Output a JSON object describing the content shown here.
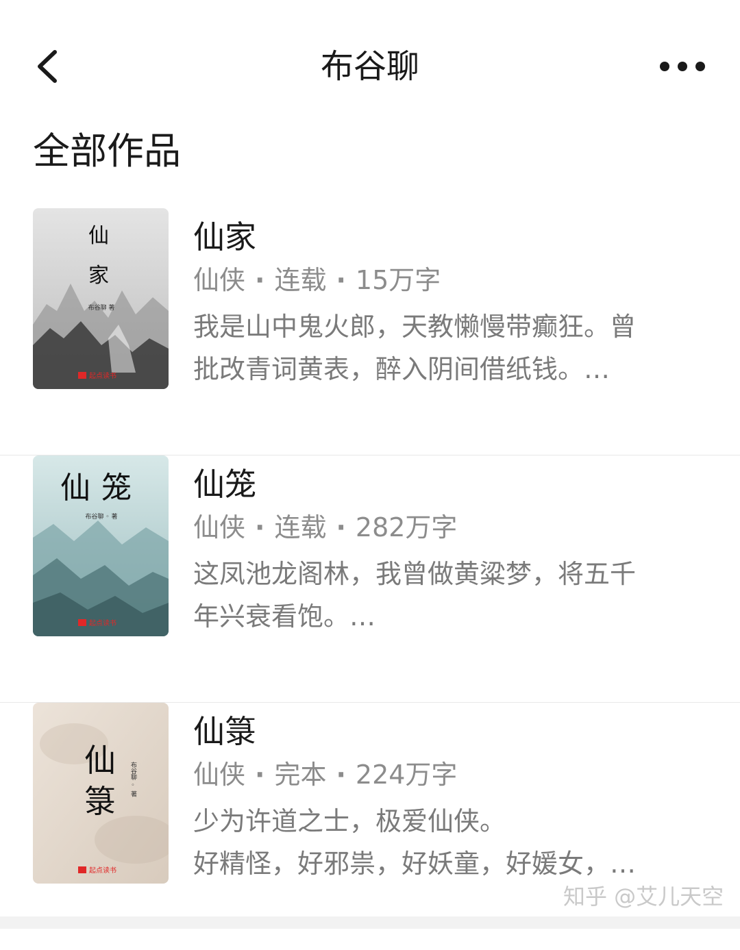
{
  "header": {
    "back_icon": "chevron-left-icon",
    "title": "布谷聊",
    "more_icon": "more-horizontal-icon"
  },
  "section": {
    "title": "全部作品"
  },
  "books": [
    {
      "title": "仙家",
      "genre": "仙侠",
      "status": "连载",
      "words": "15万字",
      "desc_lines": [
        "我是山中鬼火郎，天教懒慢带癫狂。曾",
        "批改青词黄表，醉入阴间借纸钱。…"
      ],
      "cover": {
        "title_chars": [
          "仙",
          "家"
        ],
        "author": "布谷聊 著",
        "publisher": "起点读书",
        "palette": "#d6d6d6"
      }
    },
    {
      "title": "仙笼",
      "genre": "仙侠",
      "status": "连载",
      "words": "282万字",
      "desc_lines": [
        "这凤池龙阁林，我曾做黄粱梦，将五千",
        "年兴衰看饱。…"
      ],
      "cover": {
        "title_chars": [
          "仙",
          "笼"
        ],
        "author": "布谷聊 ◦ 著",
        "publisher": "起点读书",
        "palette": "#b9d3d4"
      }
    },
    {
      "title": "仙箓",
      "genre": "仙侠",
      "status": "完本",
      "words": "224万字",
      "desc_lines": [
        "少为许道之士，极爱仙侠。",
        "好精怪，好邪祟，好妖童，好媛女，…"
      ],
      "cover": {
        "title_chars": [
          "仙",
          "箓"
        ],
        "author": "布谷聊 ◦ 著",
        "publisher": "起点读书",
        "palette": "#e6dbd0"
      }
    }
  ],
  "watermark": "知乎 @艾儿天空"
}
